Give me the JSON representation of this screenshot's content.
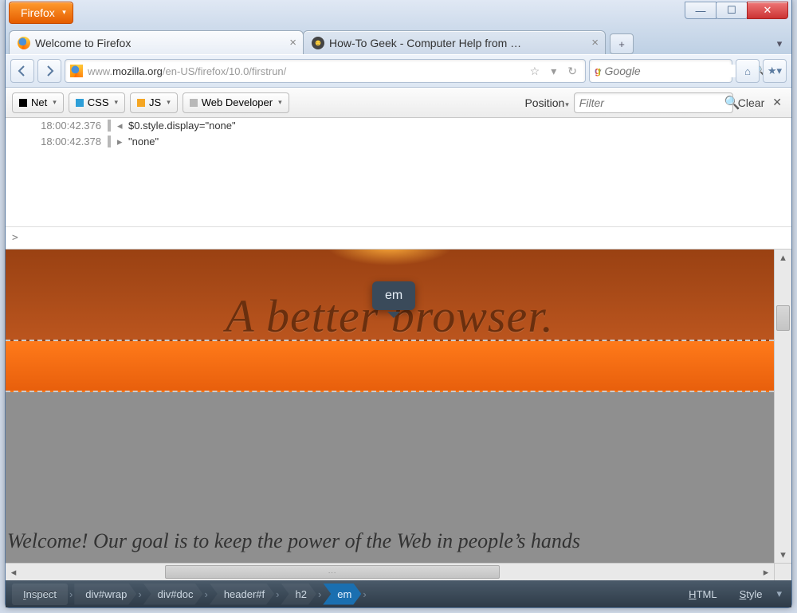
{
  "app": {
    "menu_label": "Firefox"
  },
  "window_controls": {
    "min": "—",
    "max": "☐",
    "close": "✕"
  },
  "tabs": [
    {
      "title": "Welcome to Firefox",
      "icon": "firefox-icon",
      "active": true
    },
    {
      "title": "How-To Geek - Computer Help from …",
      "icon": "htg-icon",
      "active": false
    }
  ],
  "url": {
    "dim_prefix": "www.",
    "host": "mozilla.org",
    "dim_path": "/en-US/firefox/10.0/firstrun/"
  },
  "search": {
    "placeholder": "Google"
  },
  "dev_toolbar": {
    "net": "Net",
    "css": "CSS",
    "js": "JS",
    "webdev": "Web Developer",
    "position": "Position",
    "filter_placeholder": "Filter",
    "clear": "Clear"
  },
  "console_lines": [
    {
      "ts": "18:00:42.376",
      "dir": "in",
      "code": "$0.style.display=\"none\""
    },
    {
      "ts": "18:00:42.378",
      "dir": "out",
      "code": "\"none\""
    }
  ],
  "console_prompt": ">",
  "page_preview": {
    "headline": "A better browser.",
    "tooltip": "em",
    "welcome": "Welcome! Our goal is to keep the power of the Web in people’s hands "
  },
  "inspector_bar": {
    "inspect_pre": "I",
    "inspect_rest": "nspect",
    "breadcrumbs": [
      "div#wrap",
      "div#doc",
      "header#f",
      "h2",
      "em"
    ],
    "html_u": "H",
    "html_rest": "TML",
    "style_u": "S",
    "style_rest": "tyle"
  }
}
